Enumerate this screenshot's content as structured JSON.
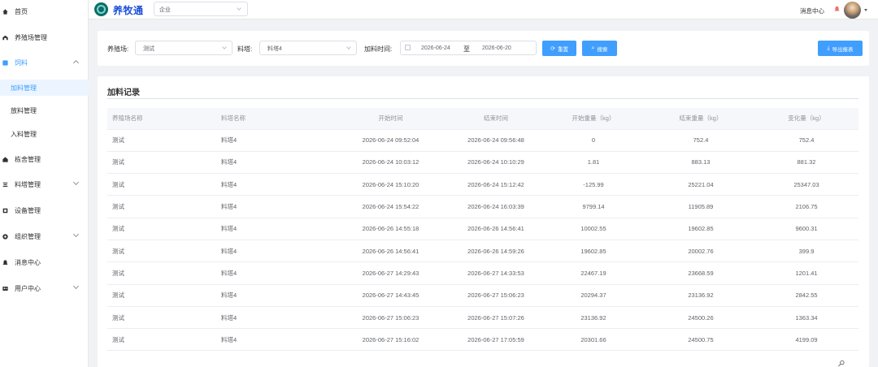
{
  "sidebar": {
    "items": [
      {
        "label": "首页",
        "icon": "home-icon"
      },
      {
        "label": "养殖场管理",
        "icon": "farm-icon"
      },
      {
        "label": "饲料",
        "icon": "feed-icon"
      },
      {
        "label": "栋舍管理",
        "icon": "house-icon"
      },
      {
        "label": "料塔管理",
        "icon": "tower-icon"
      },
      {
        "label": "设备管理",
        "icon": "device-icon"
      },
      {
        "label": "组织管理",
        "icon": "org-icon"
      },
      {
        "label": "消息中心",
        "icon": "bell-icon"
      },
      {
        "label": "用户中心",
        "icon": "user-icon"
      }
    ],
    "feed_sub": [
      {
        "label": "加料管理"
      },
      {
        "label": "放料管理"
      },
      {
        "label": "入料管理"
      }
    ]
  },
  "header": {
    "app_name": "养牧通",
    "company_select": "企业",
    "message_center": "消息中心"
  },
  "filters": {
    "farm_label": "养殖场:",
    "farm_value": "测试",
    "tower_label": "料塔:",
    "tower_value": "料塔4",
    "time_label": "加料时间:",
    "date_start": "2026-06-24",
    "date_sep": "至",
    "date_end": "2026-06-20",
    "reset_label": "重置",
    "search_label": "搜索",
    "export_label": "导出报表"
  },
  "records": {
    "title": "加料记录",
    "columns": [
      "养殖场名称",
      "料塔名称",
      "开始时间",
      "结束时间",
      "开始重量（kg）",
      "结束重量（kg）",
      "变化量（kg）"
    ],
    "rows": [
      [
        "测试",
        "料塔4",
        "2026-06-24 09:52:04",
        "2026-06-24 09:56:48",
        "0",
        "752.4",
        "752.4"
      ],
      [
        "测试",
        "料塔4",
        "2026-06-24 10:03:12",
        "2026-06-24 10:10:29",
        "1.81",
        "883.13",
        "881.32"
      ],
      [
        "测试",
        "料塔4",
        "2026-06-24 15:10:20",
        "2026-06-24 15:12:42",
        "-125.99",
        "25221.04",
        "25347.03"
      ],
      [
        "测试",
        "料塔4",
        "2026-06-24 15:54:22",
        "2026-06-24 16:03:39",
        "9799.14",
        "11905.89",
        "2106.75"
      ],
      [
        "测试",
        "料塔4",
        "2026-06-26 14:55:18",
        "2026-06-26 14:56:41",
        "10002.55",
        "19602.85",
        "9600.31"
      ],
      [
        "测试",
        "料塔4",
        "2026-06-26 14:56:41",
        "2026-06-26 14:59:26",
        "19602.85",
        "20002.76",
        "399.9"
      ],
      [
        "测试",
        "料塔4",
        "2026-06-27 14:29:43",
        "2026-06-27 14:33:53",
        "22467.19",
        "23668.59",
        "1201.41"
      ],
      [
        "测试",
        "料塔4",
        "2026-06-27 14:43:45",
        "2026-06-27 15:06:23",
        "20294.37",
        "23136.92",
        "2842.55"
      ],
      [
        "测试",
        "料塔4",
        "2026-06-27 15:06:23",
        "2026-06-27 15:07:26",
        "23136.92",
        "24500.26",
        "1363.34"
      ],
      [
        "测试",
        "料塔4",
        "2026-06-27 15:16:02",
        "2026-06-27 17:05:59",
        "20301.66",
        "24500.75",
        "4199.09"
      ]
    ]
  },
  "colors": {
    "primary": "#409eff",
    "brand_text": "#1a4fd8",
    "logo_bg": "#0b6e68"
  }
}
